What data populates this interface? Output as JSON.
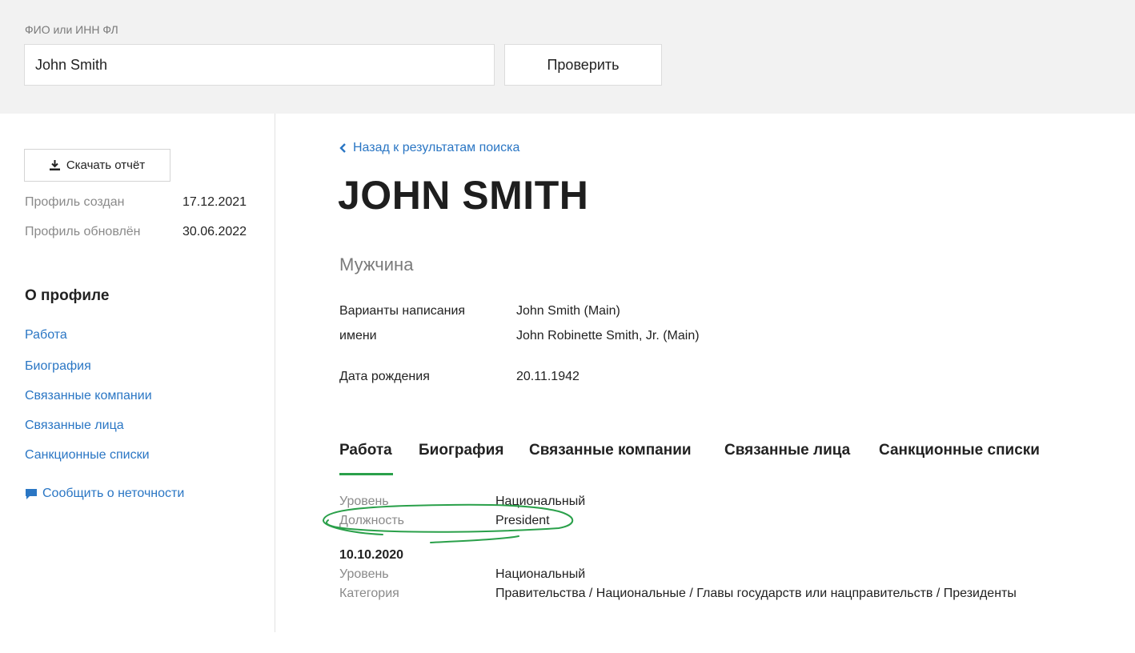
{
  "search": {
    "label": "ФИО или ИНН ФЛ",
    "value": "John Smith",
    "button": "Проверить"
  },
  "sidebar": {
    "download_label": "Скачать отчёт",
    "created_label": "Профиль создан",
    "created_value": "17.12.2021",
    "updated_label": "Профиль обновлён",
    "updated_value": "30.06.2022",
    "about_title": "О профиле",
    "links": [
      {
        "label": "Работа"
      },
      {
        "label": "Биография"
      },
      {
        "label": "Связанные компании"
      },
      {
        "label": "Связанные лица"
      },
      {
        "label": "Санкционные списки"
      }
    ],
    "report_label": "Сообщить о неточности"
  },
  "main": {
    "back_label": "Назад к результатам поиска",
    "name": "JOHN SMITH",
    "gender": "Мужчина",
    "name_variants_label_1": "Варианты написания",
    "name_variants_label_2": "имени",
    "name_variants": [
      "John Smith (Main)",
      "John Robinette Smith, Jr. (Main)"
    ],
    "birth_label": "Дата рождения",
    "birth_value": "20.11.1942",
    "tabs": [
      {
        "label": "Работа"
      },
      {
        "label": "Биография"
      },
      {
        "label": "Связанные компании"
      },
      {
        "label": "Связанные лица"
      },
      {
        "label": "Санкционные списки"
      }
    ],
    "work": {
      "level_label": "Уровень",
      "level_value": "Национальный",
      "position_label": "Должность",
      "position_value": "President",
      "entry_date": "10.10.2020",
      "entry_level_label": "Уровень",
      "entry_level_value": "Национальный",
      "entry_category_label": "Категория",
      "entry_category_value": "Правительства / Национальные / Главы государств или нацправительств / Президенты"
    }
  },
  "colors": {
    "accent_link": "#2a76c4",
    "tab_active": "#2aa04a",
    "annotation": "#2aa04a",
    "top_bar_bg": "#f2f2f2"
  }
}
